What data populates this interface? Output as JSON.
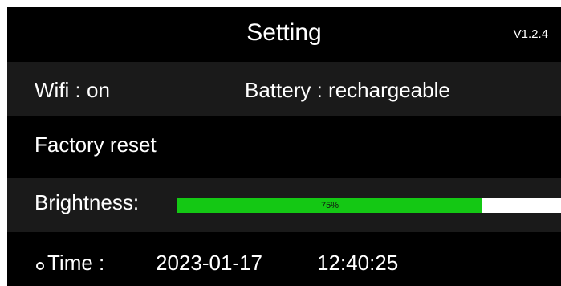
{
  "header": {
    "title": "Setting",
    "version": "V1.2.4"
  },
  "status": {
    "wifi": "Wifi : on",
    "battery": "Battery : rechargeable"
  },
  "factory_reset": {
    "label": "Factory reset"
  },
  "brightness": {
    "label": "Brightness:",
    "value_label": "75%",
    "value": 0.795
  },
  "time": {
    "label": "Time :",
    "date": "2023-01-17",
    "clock": "12:40:25"
  },
  "colors": {
    "background": "#000000",
    "row_highlight": "#1a1a1a",
    "text": "#ffffff",
    "bar_fill": "#14c814",
    "bar_track": "#ffffff"
  },
  "icons": {
    "time_marker": "ring-dot-icon"
  }
}
